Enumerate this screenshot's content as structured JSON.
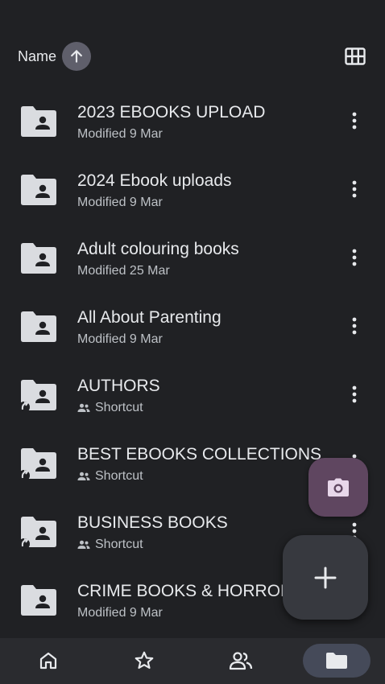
{
  "header": {
    "sort_label": "Name",
    "sort_direction_icon": "arrow-up-icon",
    "view_toggle_icon": "grid-view-icon"
  },
  "files": [
    {
      "name": "2023 EBOOKS UPLOAD",
      "subtitle": "Modified 9 Mar",
      "type": "shared-folder"
    },
    {
      "name": "2024 Ebook uploads",
      "subtitle": "Modified 9 Mar",
      "type": "shared-folder"
    },
    {
      "name": "Adult colouring books",
      "subtitle": "Modified 25 Mar",
      "type": "shared-folder"
    },
    {
      "name": "All About Parenting",
      "subtitle": "Modified 9 Mar",
      "type": "shared-folder"
    },
    {
      "name": "AUTHORS",
      "subtitle": "Shortcut",
      "type": "shortcut"
    },
    {
      "name": "BEST EBOOKS COLLECTIONS",
      "subtitle": "Shortcut",
      "type": "shortcut"
    },
    {
      "name": "BUSINESS BOOKS",
      "subtitle": "Shortcut",
      "type": "shortcut"
    },
    {
      "name": "CRIME BOOKS & HORROR",
      "subtitle": "Modified 9 Mar",
      "type": "shared-folder"
    }
  ],
  "fabs": {
    "camera_icon": "camera-icon",
    "new_icon": "plus-icon"
  },
  "bottom_nav": [
    {
      "icon": "home-icon",
      "selected": false
    },
    {
      "icon": "star-icon",
      "selected": false
    },
    {
      "icon": "shared-people-icon",
      "selected": false
    },
    {
      "icon": "folder-icon",
      "selected": true
    }
  ],
  "colors": {
    "background": "#202124",
    "text_primary": "#e8eaed",
    "text_secondary": "#bdc1c6",
    "camera_fab": "#5f4660",
    "new_fab": "#37393f",
    "nav_selected_pill": "#454a59"
  }
}
